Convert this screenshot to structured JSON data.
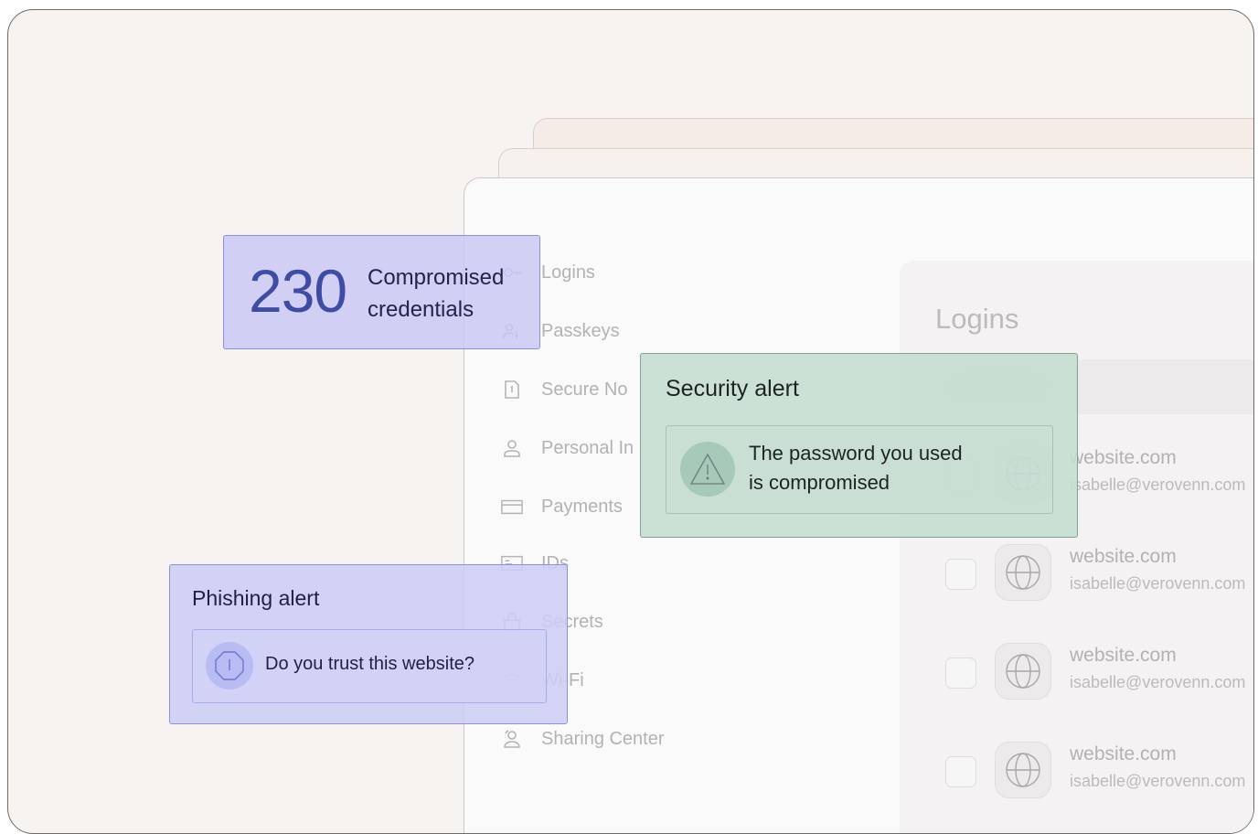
{
  "sidebar": {
    "items": [
      {
        "label": "Logins",
        "icon": "key-icon"
      },
      {
        "label": "Passkeys",
        "icon": "passkey-icon"
      },
      {
        "label": "Secure No",
        "icon": "note-icon"
      },
      {
        "label": "Personal In",
        "icon": "person-icon"
      },
      {
        "label": "Payments",
        "icon": "card-icon"
      },
      {
        "label": "IDs",
        "icon": "id-icon"
      },
      {
        "label": "Secrets",
        "icon": "secret-icon"
      },
      {
        "label": "Wi-Fi",
        "icon": "wifi-icon"
      },
      {
        "label": "Sharing Center",
        "icon": "sharing-icon"
      }
    ]
  },
  "logins": {
    "title": "Logins",
    "rows": [
      {
        "site": "website.com",
        "email": "isabelle@verovenn.com"
      },
      {
        "site": "website.com",
        "email": "isabelle@verovenn.com"
      },
      {
        "site": "website.com",
        "email": "isabelle@verovenn.com"
      },
      {
        "site": "website.com",
        "email": "isabelle@verovenn.com"
      }
    ]
  },
  "compromised_card": {
    "count": "230",
    "label": "Compromised credentials"
  },
  "security_alert": {
    "title": "Security alert",
    "message_line1": "The password you used",
    "message_line2": "is compromised"
  },
  "phishing_alert": {
    "title": "Phishing alert",
    "message": "Do you trust this website?"
  },
  "colors": {
    "background": "#f7f3f1",
    "compromised_card": "#c8c8f4",
    "security_card": "#c4ddd0",
    "phishing_card": "#cdcdf5",
    "accent_number": "#3e4da3"
  }
}
